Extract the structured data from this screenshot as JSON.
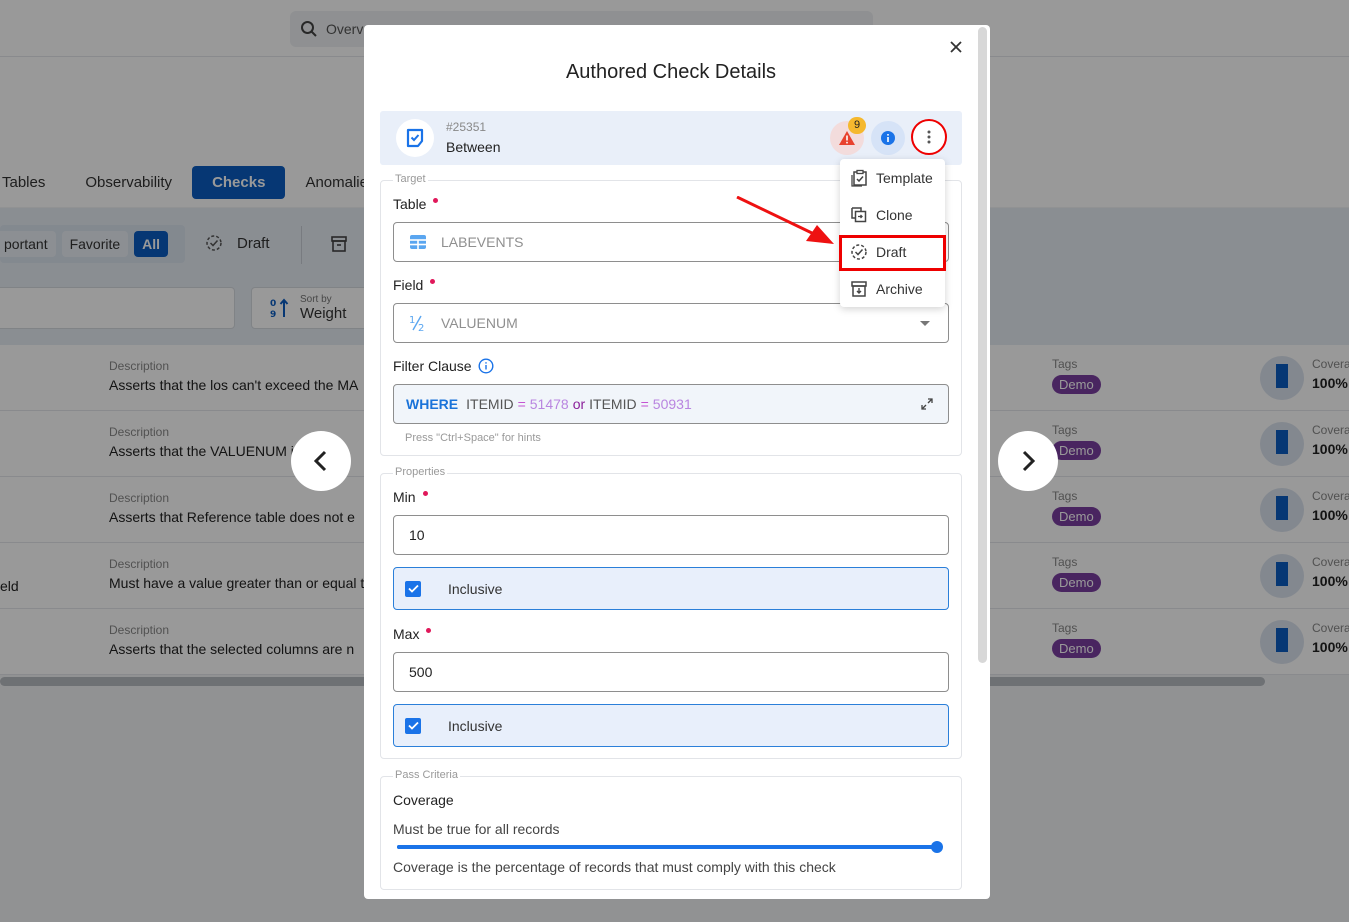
{
  "background": {
    "search_text": "Overv",
    "tabs": [
      {
        "label": "Tables",
        "active": false
      },
      {
        "label": "Observability",
        "active": false
      },
      {
        "label": "Checks",
        "active": true
      },
      {
        "label": "Anomalie",
        "active": false
      }
    ],
    "filter_chips": [
      {
        "label": "portant",
        "active": false
      },
      {
        "label": "Favorite",
        "active": false
      },
      {
        "label": "All",
        "active": true
      }
    ],
    "draft_label": "Draft",
    "sort": {
      "small_label": "Sort by",
      "value": "Weight"
    },
    "rows": [
      {
        "left_text": "",
        "desc_label": "Description",
        "description": "Asserts that the los can't exceed the MA",
        "tags_label": "Tags",
        "tag": "Demo",
        "coverage_label": "Covera",
        "coverage": "100%"
      },
      {
        "left_text": "",
        "desc_label": "Description",
        "description": "Asserts that the VALUENUM is BE",
        "tags_label": "Tags",
        "tag": "Demo",
        "coverage_label": "Covera",
        "coverage": "100%"
      },
      {
        "left_text": "",
        "desc_label": "Description",
        "description": "Asserts that Reference table does not e",
        "tags_label": "Tags",
        "tag": "Demo",
        "coverage_label": "Covera",
        "coverage": "100%"
      },
      {
        "left_text": "eld",
        "desc_label": "Description",
        "description": "Must have a value greater than or equal t",
        "tags_label": "Tags",
        "tag": "Demo",
        "coverage_label": "Covera",
        "coverage": "100%"
      },
      {
        "left_text": "",
        "desc_label": "Description",
        "description": "Asserts that the selected columns are n",
        "tags_label": "Tags",
        "tag": "Demo",
        "coverage_label": "Covera",
        "coverage": "100%"
      }
    ]
  },
  "modal": {
    "title": "Authored Check Details",
    "check": {
      "id": "#25351",
      "name": "Between",
      "anomaly_count": "9"
    },
    "menu": {
      "items": [
        {
          "label": "Template",
          "icon": "clipboard-check-icon"
        },
        {
          "label": "Clone",
          "icon": "clone-icon"
        },
        {
          "label": "Draft",
          "icon": "draft-icon",
          "highlighted": true
        },
        {
          "label": "Archive",
          "icon": "archive-icon"
        }
      ]
    },
    "target": {
      "legend": "Target",
      "table_label": "Table",
      "table_value": "LABEVENTS",
      "field_label": "Field",
      "field_value": "VALUENUM",
      "filter_label": "Filter Clause",
      "filter": {
        "keyword": "WHERE",
        "ident1": "ITEMID",
        "op1": "=",
        "num1": "51478",
        "conj": "or",
        "ident2": "ITEMID",
        "op2": "=",
        "num2": "50931"
      },
      "hint": "Press \"Ctrl+Space\" for hints"
    },
    "properties": {
      "legend": "Properties",
      "min_label": "Min",
      "min_value": "10",
      "min_inclusive_label": "Inclusive",
      "min_inclusive": true,
      "max_label": "Max",
      "max_value": "500",
      "max_inclusive_label": "Inclusive",
      "max_inclusive": true
    },
    "pass_criteria": {
      "legend": "Pass Criteria",
      "title": "Coverage",
      "subtitle": "Must be true for all records",
      "coverage_fraction": 1.0,
      "description": "Coverage is the percentage of records that must comply with this check"
    }
  },
  "colors": {
    "accent": "#1a73e8",
    "required": "#e0185a",
    "annotation_red": "#ee0000",
    "tag_purple": "#7b3fa0",
    "badge_yellow": "#f5b82e"
  }
}
